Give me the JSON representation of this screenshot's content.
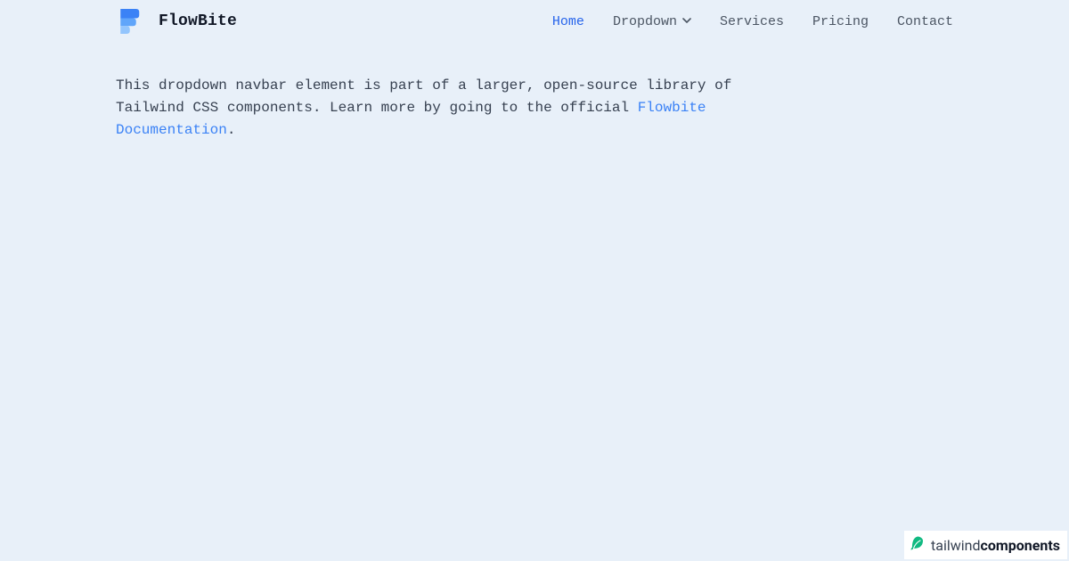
{
  "brand": {
    "name": "FlowBite"
  },
  "nav": {
    "items": [
      {
        "label": "Home",
        "active": true,
        "hasDropdown": false
      },
      {
        "label": "Dropdown",
        "active": false,
        "hasDropdown": true
      },
      {
        "label": "Services",
        "active": false,
        "hasDropdown": false
      },
      {
        "label": "Pricing",
        "active": false,
        "hasDropdown": false
      },
      {
        "label": "Contact",
        "active": false,
        "hasDropdown": false
      }
    ]
  },
  "content": {
    "description_part1": "This dropdown navbar element is part of a larger, open-source library of Tailwind CSS components. Learn more by going to the official ",
    "doc_link_text": "Flowbite Documentation",
    "description_part2": "."
  },
  "footer": {
    "light": "tailwind",
    "bold": "components"
  },
  "colors": {
    "background": "#e8f0f9",
    "accent": "#2563eb",
    "text": "#374151",
    "link": "#3b82f6",
    "leaf": "#10b981"
  }
}
